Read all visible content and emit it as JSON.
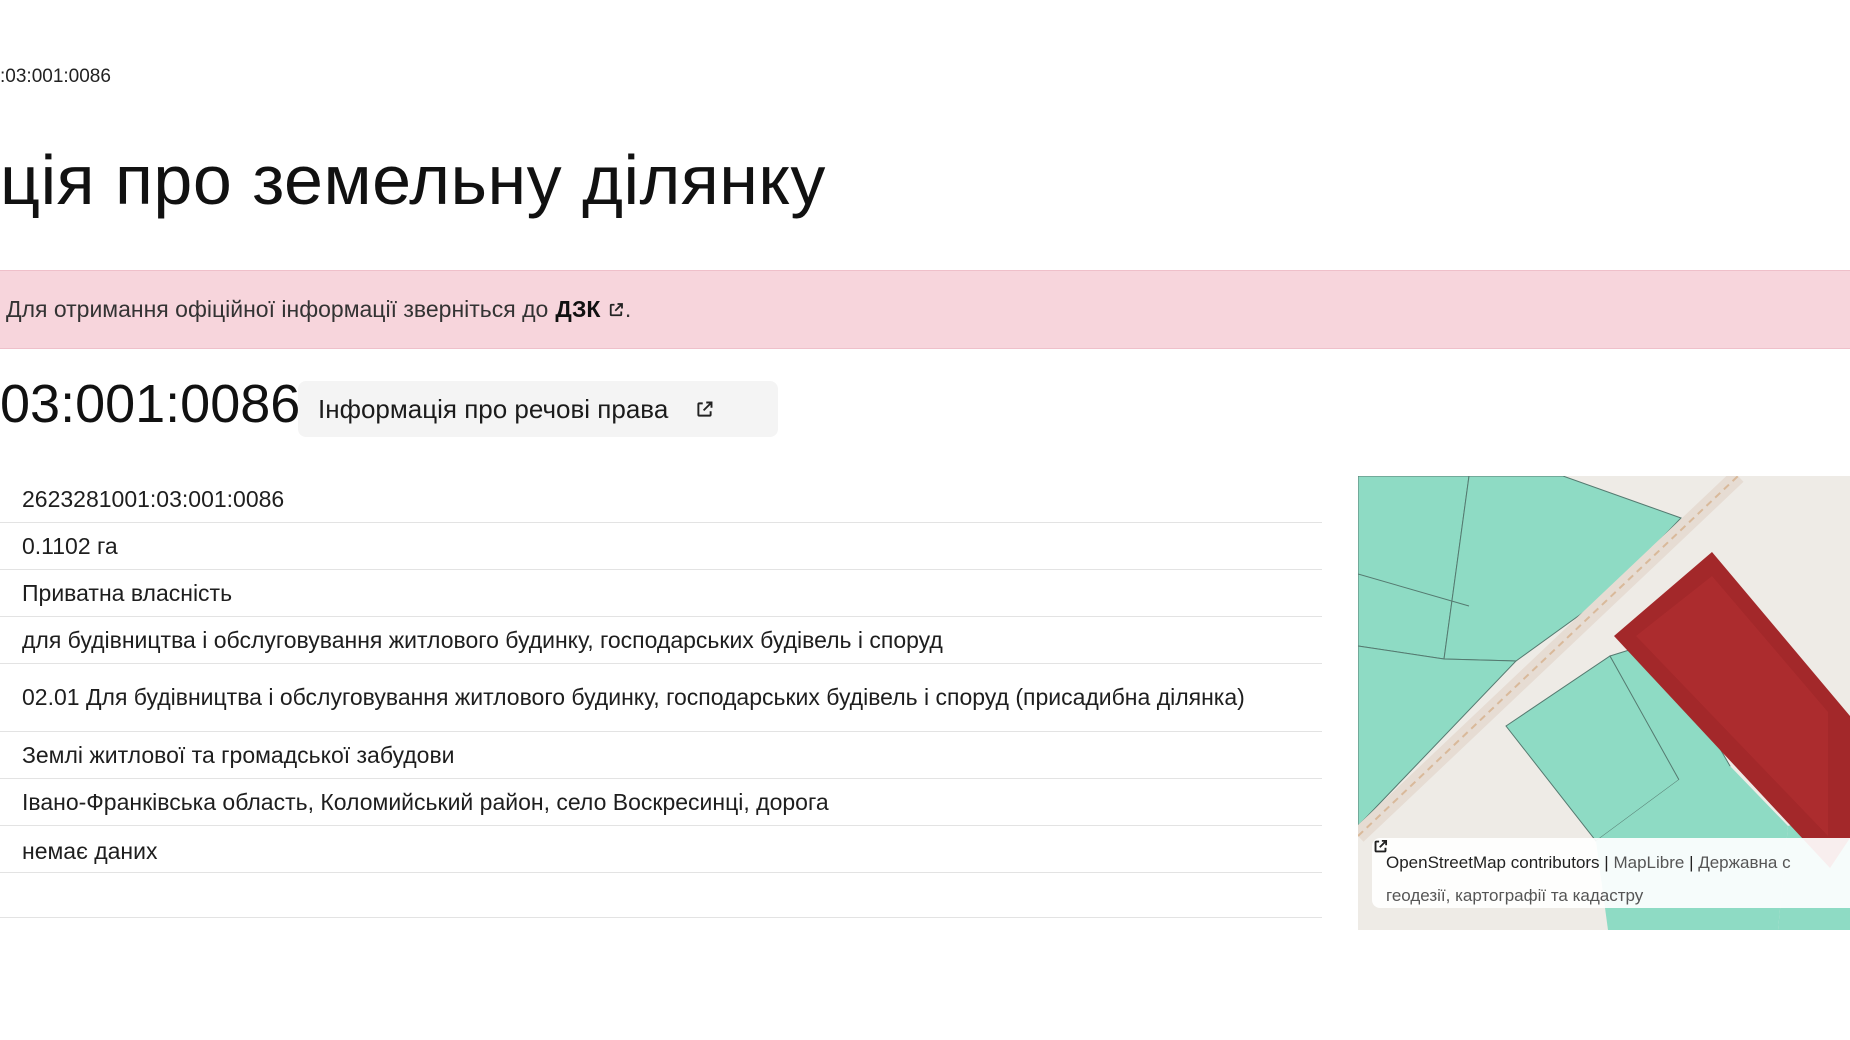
{
  "breadcrumb": ":03:001:0086",
  "title": "ція про земельну ділянку",
  "notice": {
    "text": "Для отримання офіційної інформації зверніться до",
    "link": "ДЗК",
    "tail": "."
  },
  "parcel": {
    "cadastral_number": "03:001:0086",
    "rights_button": "Інформація про речові права"
  },
  "info_rows": [
    "2623281001:03:001:0086",
    "0.1102 га",
    "Приватна власність",
    "для будівництва і обслуговування житлового будинку, господарських будівель і споруд",
    "02.01 Для будівництва і обслуговування житлового будинку, господарських будівель і споруд (присадибна ділянка)",
    "Землі житлової та громадської забудови",
    "Івано-Франківська область, Коломийський район, село Воскресинці, дорога",
    "немає даних"
  ],
  "map": {
    "attribution_osm": "OpenStreetMap contributors",
    "attribution_sep1": "|",
    "attribution_maplibre": "MapLibre",
    "attribution_sep2": "|",
    "attribution_gov": "Державна с",
    "attribution_gov_line2": "геодезії, картографії та кадастру",
    "colors": {
      "parcel_green": "#8edbc4",
      "selected_parcel": "#a3282a",
      "background": "#eeebe6",
      "road": "#d9b99a"
    }
  },
  "icons": {
    "external_link": "external-link-icon"
  }
}
